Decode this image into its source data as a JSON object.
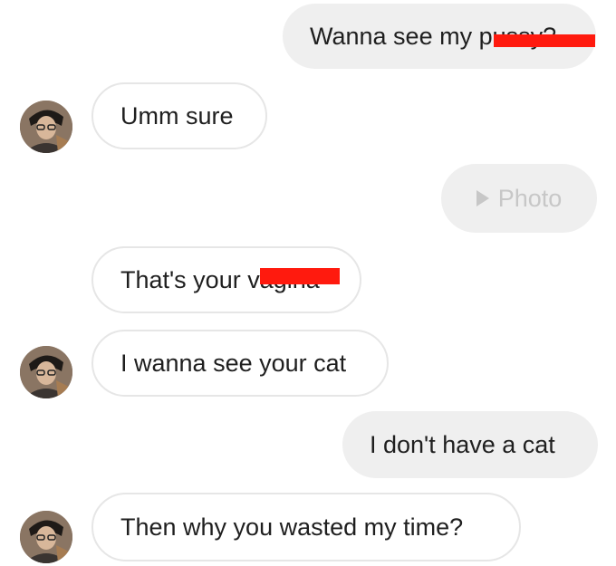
{
  "conversation": {
    "messages": [
      {
        "from": "me",
        "text": "Wanna see my pussy?"
      },
      {
        "from": "them",
        "text": "Umm sure"
      },
      {
        "from": "me",
        "type": "photo",
        "text": "Photo",
        "icon": "play-icon"
      },
      {
        "from": "them",
        "text": "That's your vagina"
      },
      {
        "from": "them",
        "text": "I wanna see your cat"
      },
      {
        "from": "me",
        "text": "I don't have a cat"
      },
      {
        "from": "them",
        "text": "Then why you wasted my time?"
      }
    ],
    "avatar_icon": "user-avatar"
  },
  "colors": {
    "outgoing_bubble": "#efefef",
    "incoming_border": "#e6e6e6",
    "redaction": "#ff1a0e",
    "photo_text": "#c7c7c7"
  }
}
